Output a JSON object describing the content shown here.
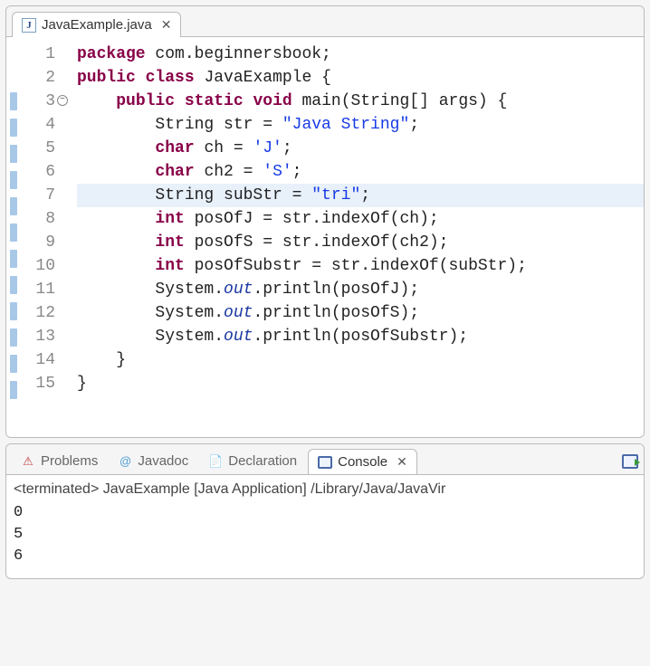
{
  "editor": {
    "tab": {
      "filename": "JavaExample.java",
      "file_icon_letter": "J"
    },
    "highlighted_line": 7,
    "fold_line": 3,
    "blue_gutter_lines": [
      3,
      4,
      5,
      6,
      7,
      8,
      9,
      10,
      11,
      12,
      13,
      14
    ],
    "lines": [
      {
        "n": 1,
        "tokens": [
          [
            "kw",
            "package"
          ],
          [
            "",
            " com.beginnersbook;"
          ]
        ]
      },
      {
        "n": 2,
        "tokens": [
          [
            "kw",
            "public"
          ],
          [
            "",
            " "
          ],
          [
            "kw",
            "class"
          ],
          [
            "",
            " JavaExample {"
          ]
        ]
      },
      {
        "n": 3,
        "tokens": [
          [
            "",
            "    "
          ],
          [
            "kw",
            "public"
          ],
          [
            "",
            " "
          ],
          [
            "kw",
            "static"
          ],
          [
            "",
            " "
          ],
          [
            "kw",
            "void"
          ],
          [
            "",
            " main(String[] args) {"
          ]
        ]
      },
      {
        "n": 4,
        "tokens": [
          [
            "",
            "        String str = "
          ],
          [
            "str",
            "\"Java String\""
          ],
          [
            "",
            ";"
          ]
        ]
      },
      {
        "n": 5,
        "tokens": [
          [
            "",
            "        "
          ],
          [
            "kw",
            "char"
          ],
          [
            "",
            " ch = "
          ],
          [
            "str",
            "'J'"
          ],
          [
            "",
            ";"
          ]
        ]
      },
      {
        "n": 6,
        "tokens": [
          [
            "",
            "        "
          ],
          [
            "kw",
            "char"
          ],
          [
            "",
            " ch2 = "
          ],
          [
            "str",
            "'S'"
          ],
          [
            "",
            ";"
          ]
        ]
      },
      {
        "n": 7,
        "tokens": [
          [
            "",
            "        String subStr = "
          ],
          [
            "str",
            "\"tri\""
          ],
          [
            "",
            ";"
          ]
        ]
      },
      {
        "n": 8,
        "tokens": [
          [
            "",
            "        "
          ],
          [
            "kw",
            "int"
          ],
          [
            "",
            " posOfJ = str.indexOf(ch);"
          ]
        ]
      },
      {
        "n": 9,
        "tokens": [
          [
            "",
            "        "
          ],
          [
            "kw",
            "int"
          ],
          [
            "",
            " posOfS = str.indexOf(ch2);"
          ]
        ]
      },
      {
        "n": 10,
        "tokens": [
          [
            "",
            "        "
          ],
          [
            "kw",
            "int"
          ],
          [
            "",
            " posOfSubstr = str.indexOf(subStr);"
          ]
        ]
      },
      {
        "n": 11,
        "tokens": [
          [
            "",
            "        System."
          ],
          [
            "field",
            "out"
          ],
          [
            "",
            ".println(posOfJ);"
          ]
        ]
      },
      {
        "n": 12,
        "tokens": [
          [
            "",
            "        System."
          ],
          [
            "field",
            "out"
          ],
          [
            "",
            ".println(posOfS);"
          ]
        ]
      },
      {
        "n": 13,
        "tokens": [
          [
            "",
            "        System."
          ],
          [
            "field",
            "out"
          ],
          [
            "",
            ".println(posOfSubstr);"
          ]
        ]
      },
      {
        "n": 14,
        "tokens": [
          [
            "",
            "    }"
          ]
        ]
      },
      {
        "n": 15,
        "tokens": [
          [
            "",
            "}"
          ]
        ]
      }
    ]
  },
  "bottom": {
    "tabs": {
      "problems": "Problems",
      "javadoc": "Javadoc",
      "declaration": "Declaration",
      "console": "Console"
    },
    "active_tab": "console",
    "status": "<terminated> JavaExample [Java Application] /Library/Java/JavaVir",
    "output": [
      "0",
      "5",
      "6"
    ]
  }
}
